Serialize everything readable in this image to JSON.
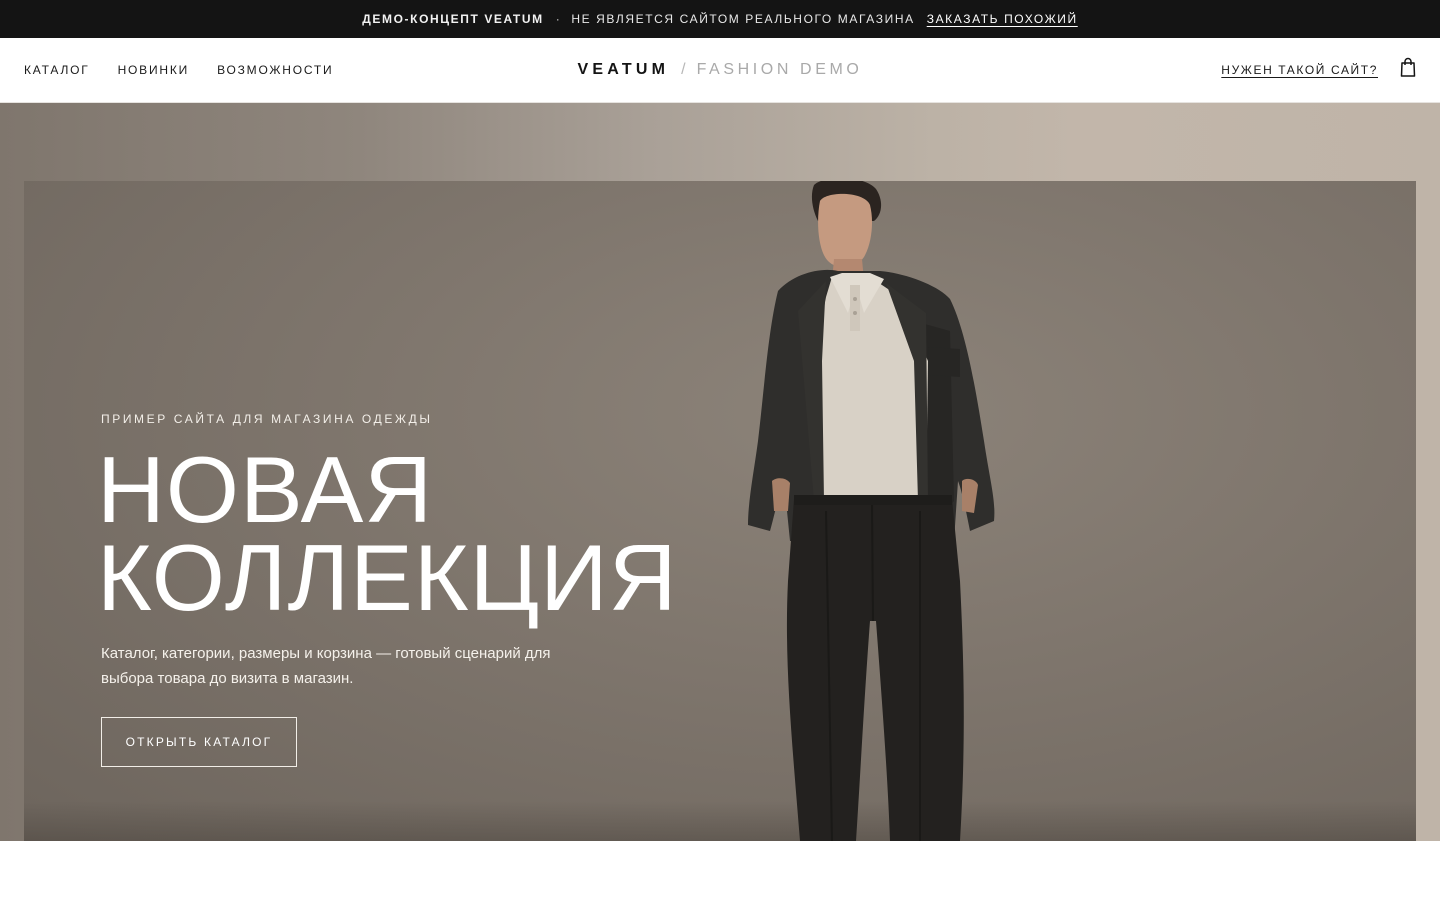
{
  "topbar": {
    "brand": "ДЕМО-КОНЦЕПТ VEATUM",
    "separator": "·",
    "note": "НЕ ЯВЛЯЕТСЯ САЙТОМ РЕАЛЬНОГО МАГАЗИНА",
    "order_link": "ЗАКАЗАТЬ ПОХОЖИЙ"
  },
  "header": {
    "nav": [
      {
        "label": "КАТАЛОГ"
      },
      {
        "label": "НОВИНКИ"
      },
      {
        "label": "ВОЗМОЖНОСТИ"
      }
    ],
    "logo": {
      "word": "VEATUM",
      "slash": "/",
      "sub": "FASHION DEMO"
    },
    "cta_link": "НУЖЕН ТАКОЙ САЙТ?",
    "bag_icon": "shopping-bag-icon"
  },
  "hero": {
    "eyebrow": "ПРИМЕР САЙТА ДЛЯ МАГАЗИНА ОДЕЖДЫ",
    "headline_line1": "НОВАЯ",
    "headline_line2": "КОЛЛЕКЦИЯ",
    "description": "Каталог, категории, размеры и корзина — готовый сценарий для выбора товара до визита в магазин.",
    "button_label": "ОТКРЫТЬ КАТАЛОГ"
  },
  "colors": {
    "topbar_bg": "#141414",
    "hero_bg": "#7e756c",
    "text_light": "#ffffff"
  }
}
